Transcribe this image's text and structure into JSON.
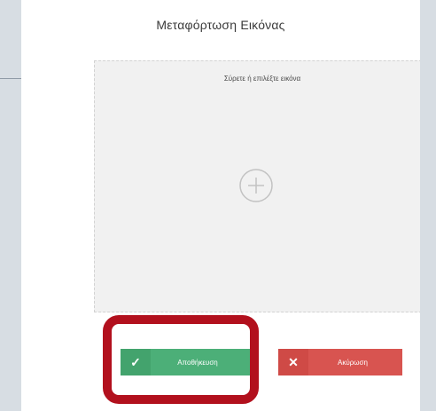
{
  "dialog": {
    "title": "Μεταφόρτωση Εικόνας",
    "dropzone_hint": "Σύρετε ή επιλέξτε εικόνα",
    "upload_button_label": "Αποθήκευση",
    "cancel_button_label": "Ακύρωση"
  },
  "icons": {
    "add": "plus-circle-icon",
    "confirm": "check-icon",
    "cancel": "close-icon"
  },
  "colors": {
    "upload": "#4caf78",
    "cancel": "#d85450",
    "highlight": "#b2101d"
  }
}
